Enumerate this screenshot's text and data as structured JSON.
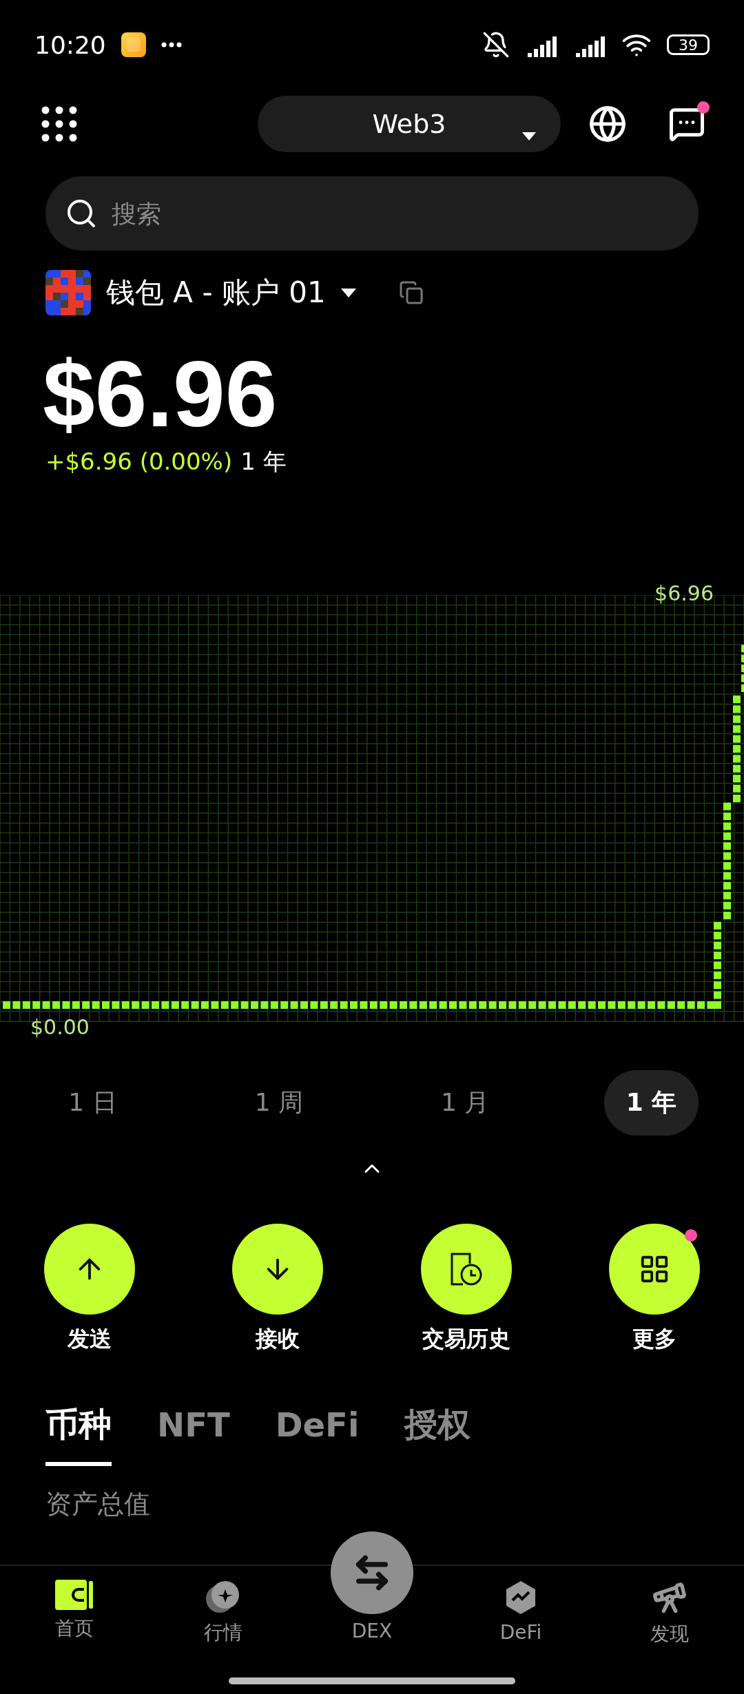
{
  "status_bar": {
    "time": "10:20",
    "battery": "39"
  },
  "header": {
    "network": "Web3",
    "messages_unread": true
  },
  "search": {
    "placeholder": "搜索"
  },
  "wallet": {
    "name": "钱包 A - 账户 01"
  },
  "balance": {
    "value": "$6.96",
    "change": "+$6.96 (0.00%)",
    "period": "1 年"
  },
  "chart": {
    "high_label": "$6.96",
    "low_label": "$0.00"
  },
  "periods": [
    {
      "label": "1 日",
      "selected": false
    },
    {
      "label": "1 周",
      "selected": false
    },
    {
      "label": "1 月",
      "selected": false
    },
    {
      "label": "1 年",
      "selected": true
    }
  ],
  "actions": [
    {
      "label": "发送",
      "kind": "send",
      "unread": false
    },
    {
      "label": "接收",
      "kind": "receive",
      "unread": false
    },
    {
      "label": "交易历史",
      "kind": "history",
      "unread": false
    },
    {
      "label": "更多",
      "kind": "more",
      "unread": true
    }
  ],
  "asset_tabs": [
    {
      "label": "币种",
      "selected": true
    },
    {
      "label": "NFT",
      "selected": false
    },
    {
      "label": "DeFi",
      "selected": false
    },
    {
      "label": "授权",
      "selected": false
    }
  ],
  "section_title": "资产总值",
  "nav": [
    {
      "label": "首页",
      "kind": "home",
      "selected": true
    },
    {
      "label": "行情",
      "kind": "market",
      "selected": false
    },
    {
      "label": "DEX",
      "kind": "dex",
      "selected": false
    },
    {
      "label": "DeFi",
      "kind": "defi",
      "selected": false
    },
    {
      "label": "发现",
      "kind": "discover",
      "selected": false
    }
  ]
}
